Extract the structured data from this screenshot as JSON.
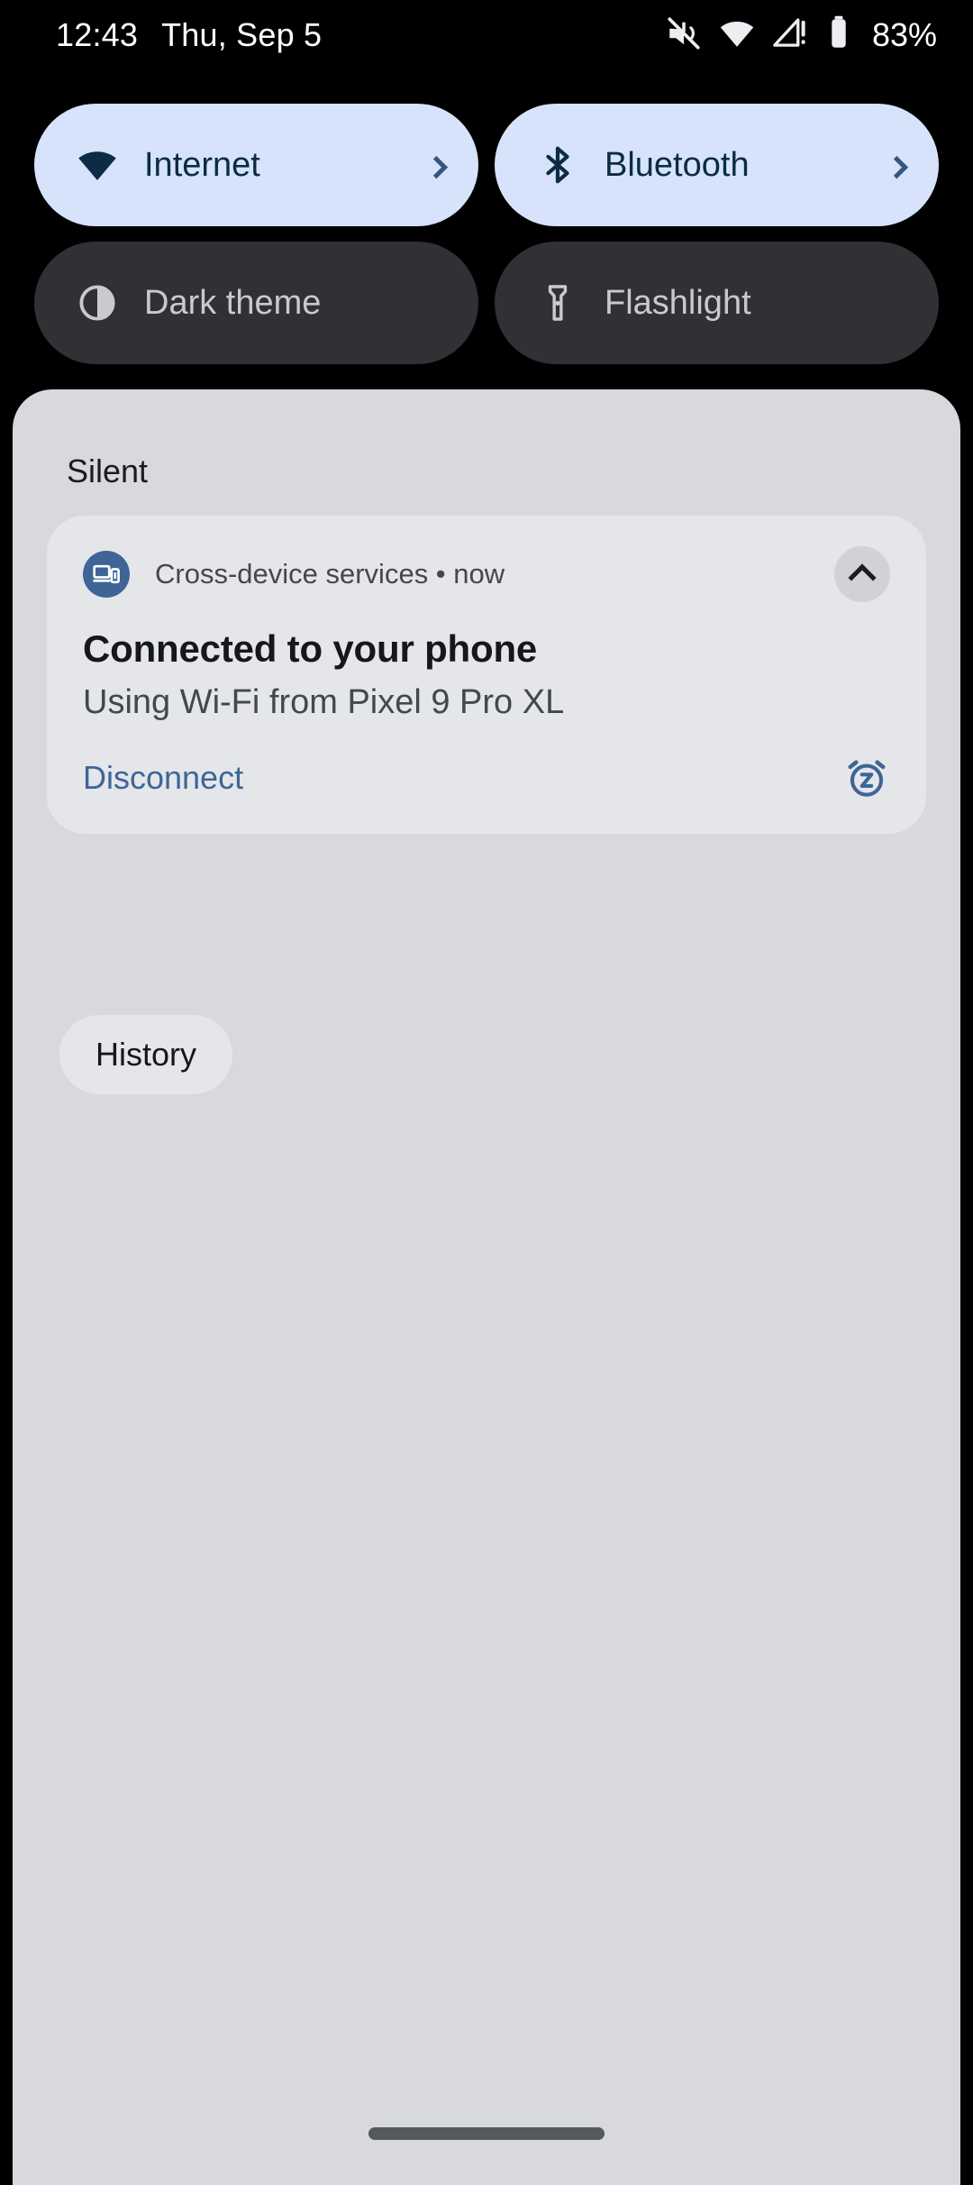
{
  "status_bar": {
    "time": "12:43",
    "date": "Thu, Sep 5",
    "battery_percent": "83%",
    "icons": [
      "mute-icon",
      "wifi-icon",
      "cell-signal-warning-icon",
      "battery-icon"
    ]
  },
  "quick_settings": {
    "tiles": [
      {
        "label": "Internet",
        "icon": "wifi-icon",
        "state": "on",
        "has_chevron": true
      },
      {
        "label": "Bluetooth",
        "icon": "bluetooth-icon",
        "state": "on",
        "has_chevron": true
      },
      {
        "label": "Dark theme",
        "icon": "contrast-icon",
        "state": "off",
        "has_chevron": false
      },
      {
        "label": "Flashlight",
        "icon": "flashlight-icon",
        "state": "off",
        "has_chevron": false
      }
    ]
  },
  "shade": {
    "section_title": "Silent",
    "notification": {
      "app_name": "Cross-device services",
      "separator": "•",
      "time": "now",
      "header_line": "Cross-device services • now",
      "title": "Connected to your phone",
      "body": "Using Wi-Fi from Pixel 9 Pro XL",
      "action_label": "Disconnect",
      "app_icon": "devices-icon",
      "expand_icon": "chevron-up-icon",
      "snooze_icon": "snooze-alarm-icon"
    },
    "history_label": "History"
  },
  "colors": {
    "tile_on_bg": "#D7E3FA",
    "tile_on_fg": "#0C2B45",
    "tile_off_bg": "#2F3134",
    "tile_off_fg": "#C9CACE",
    "shade_bg": "#D7D9DD",
    "notification_bg": "#E4E6EA",
    "accent_blue": "#3F6596",
    "app_icon_bg": "#3E6596"
  }
}
